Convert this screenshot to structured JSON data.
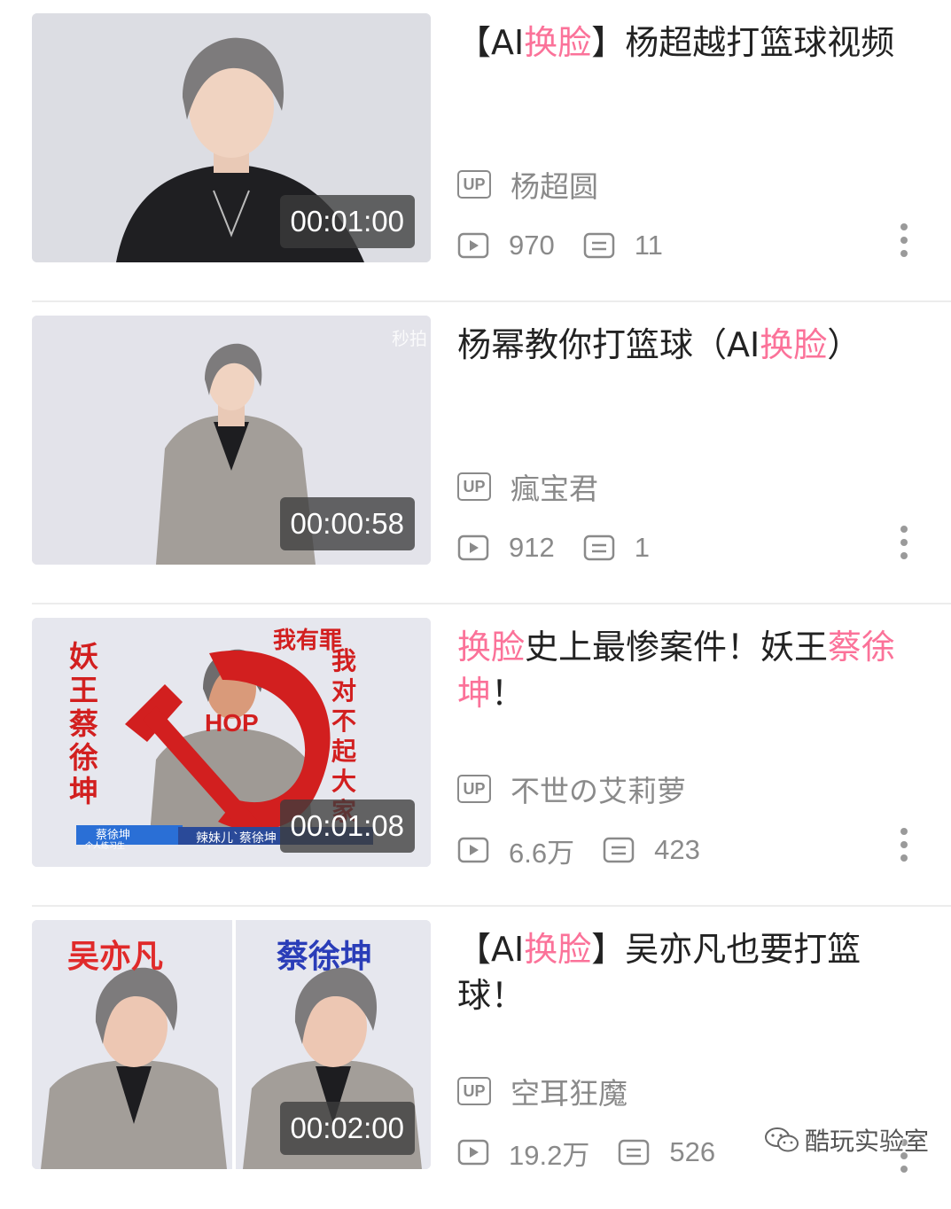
{
  "videos": [
    {
      "title_parts": [
        {
          "text": "【AI",
          "hl": false
        },
        {
          "text": "换脸",
          "hl": true
        },
        {
          "text": "】杨超越打篮球视频",
          "hl": false
        }
      ],
      "duration": "00:01:00",
      "uploader": "杨超圆",
      "views": "970",
      "comments": "11"
    },
    {
      "title_parts": [
        {
          "text": "杨幂教你打篮球（AI",
          "hl": false
        },
        {
          "text": "换脸",
          "hl": true
        },
        {
          "text": "）",
          "hl": false
        }
      ],
      "duration": "00:00:58",
      "uploader": "瘋宝君",
      "views": "912",
      "comments": "1",
      "thumb_watermark": "秒拍"
    },
    {
      "title_parts": [
        {
          "text": "换脸",
          "hl": true
        },
        {
          "text": "史上最惨案件！妖王",
          "hl": false
        },
        {
          "text": "蔡徐坤",
          "hl": true
        },
        {
          "text": "！",
          "hl": false
        }
      ],
      "duration": "00:01:08",
      "uploader": "不世の艾莉萝",
      "views": "6.6万",
      "comments": "423",
      "thumb_text": {
        "left_vertical": "妖王蔡徐坤",
        "top_right": "我有罪",
        "right_vertical": "我对不起大家",
        "center": "HOP",
        "caption_name": "蔡徐坤",
        "caption_sub": "个人练习生",
        "caption_bar": "辣妹儿`蔡徐坤"
      }
    },
    {
      "title_parts": [
        {
          "text": "【AI",
          "hl": false
        },
        {
          "text": "换脸",
          "hl": true
        },
        {
          "text": "】吴亦凡也要打篮球！",
          "hl": false
        }
      ],
      "duration": "00:02:00",
      "uploader": "空耳狂魔",
      "views": "19.2万",
      "comments": "526",
      "thumb_text": {
        "left_label": "吴亦凡",
        "right_label": "蔡徐坤"
      }
    }
  ],
  "icons": {
    "uploader": "up-badge-icon",
    "views": "play-count-icon",
    "comments": "comment-count-icon",
    "more": "more-vertical-icon"
  },
  "up_badge_text": "UP",
  "watermark": "酷玩实验室",
  "colors": {
    "highlight": "#fb7299",
    "meta": "#8a8a8a"
  }
}
